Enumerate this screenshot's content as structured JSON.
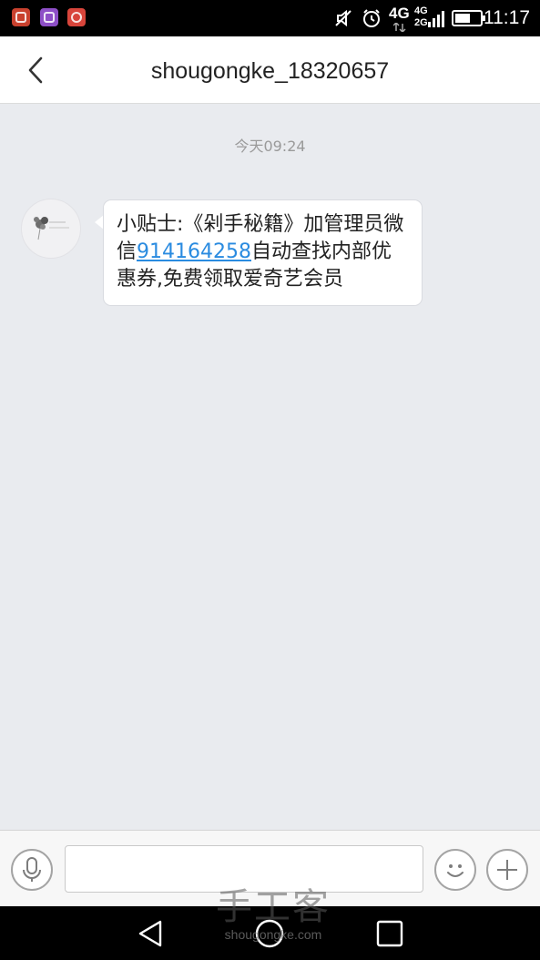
{
  "status_bar": {
    "time": "11:17",
    "network": "4G",
    "dual_sim_top": "4G",
    "dual_sim_bottom": "2G",
    "notification_apps": [
      "app-icon",
      "gallery-icon",
      "search-app-icon"
    ],
    "colors": {
      "app1": "#c9412e",
      "app2": "#8e4fc7",
      "app3": "#d8453b"
    }
  },
  "header": {
    "title": "shougongke_18320657",
    "back_icon": "chevron-left-icon"
  },
  "chat": {
    "timestamp": "今天09:24",
    "message": {
      "text_before": "小贴士:《剁手秘籍》加管理员微信",
      "link": "914164258",
      "text_after": "自动查找内部优惠券,免费领取爱奇艺会员"
    }
  },
  "input_bar": {
    "voice_icon": "microphone-icon",
    "emoji_icon": "smiley-icon",
    "add_icon": "plus-icon",
    "text_value": ""
  },
  "nav": {
    "icons": [
      "back-triangle-icon",
      "home-circle-icon",
      "recents-square-icon"
    ]
  },
  "watermark": {
    "cn": "手工客",
    "en": "shougongke.com"
  },
  "colors": {
    "link": "#2a8be0",
    "chat_bg": "#e9ebef"
  }
}
